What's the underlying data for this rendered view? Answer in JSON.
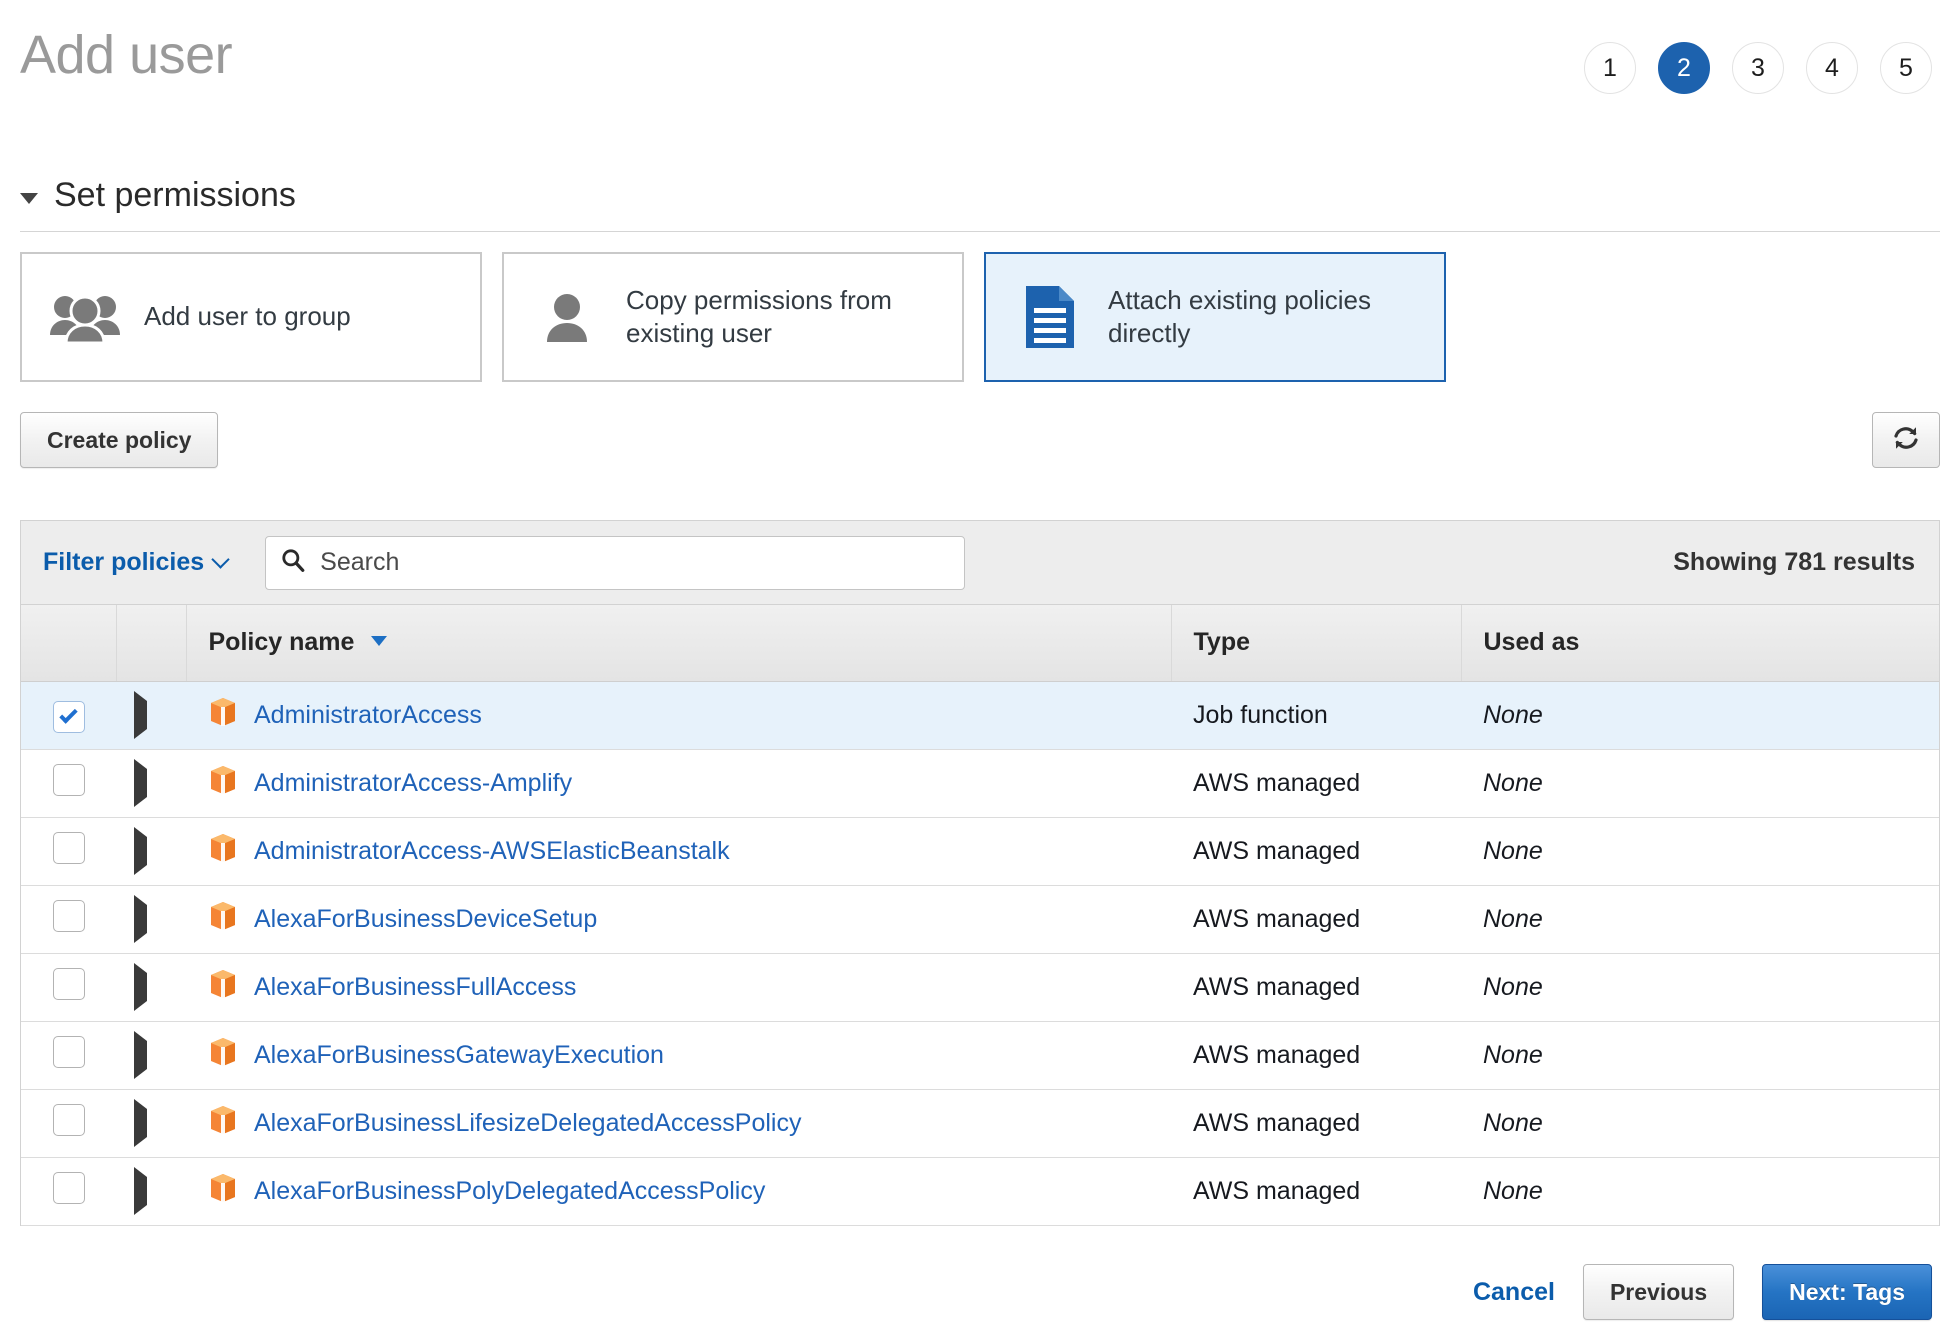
{
  "header": {
    "title": "Add user",
    "steps": [
      {
        "label": "1",
        "active": false
      },
      {
        "label": "2",
        "active": true
      },
      {
        "label": "3",
        "active": false
      },
      {
        "label": "4",
        "active": false
      },
      {
        "label": "5",
        "active": false
      }
    ]
  },
  "section": {
    "title": "Set permissions",
    "expanded": true
  },
  "permission_options": [
    {
      "label": "Add user to group",
      "icon": "group-users-icon",
      "selected": false
    },
    {
      "label": "Copy permissions from existing user",
      "icon": "single-user-icon",
      "selected": false
    },
    {
      "label": "Attach existing policies directly",
      "icon": "document-policy-icon",
      "selected": true
    }
  ],
  "toolbar": {
    "create_policy_label": "Create policy",
    "refresh_icon": "refresh-icon"
  },
  "filterbar": {
    "filter_label": "Filter policies",
    "filter_chevron_icon": "chevron-down-icon",
    "search_icon": "search-icon",
    "search_value": "",
    "search_placeholder": "Search",
    "results_text": "Showing 781 results"
  },
  "table": {
    "columns": [
      "",
      "",
      "Policy name",
      "Type",
      "Used as"
    ],
    "sorted_column": "Policy name",
    "sort_direction": "desc",
    "rows": [
      {
        "checked": true,
        "name": "AdministratorAccess",
        "type": "Job function",
        "used_as": "None"
      },
      {
        "checked": false,
        "name": "AdministratorAccess-Amplify",
        "type": "AWS managed",
        "used_as": "None"
      },
      {
        "checked": false,
        "name": "AdministratorAccess-AWSElasticBeanstalk",
        "type": "AWS managed",
        "used_as": "None"
      },
      {
        "checked": false,
        "name": "AlexaForBusinessDeviceSetup",
        "type": "AWS managed",
        "used_as": "None"
      },
      {
        "checked": false,
        "name": "AlexaForBusinessFullAccess",
        "type": "AWS managed",
        "used_as": "None"
      },
      {
        "checked": false,
        "name": "AlexaForBusinessGatewayExecution",
        "type": "AWS managed",
        "used_as": "None"
      },
      {
        "checked": false,
        "name": "AlexaForBusinessLifesizeDelegatedAccessPolicy",
        "type": "AWS managed",
        "used_as": "None"
      },
      {
        "checked": false,
        "name": "AlexaForBusinessPolyDelegatedAccessPolicy",
        "type": "AWS managed",
        "used_as": "None"
      }
    ]
  },
  "footer": {
    "cancel_label": "Cancel",
    "previous_label": "Previous",
    "next_label": "Next: Tags"
  },
  "colors": {
    "accent_blue": "#1d62ae",
    "link_blue": "#1f62b8",
    "selected_row_bg": "#e7f2fb",
    "policy_icon_orange": "#f58536",
    "title_grey": "#9a9a9a"
  }
}
